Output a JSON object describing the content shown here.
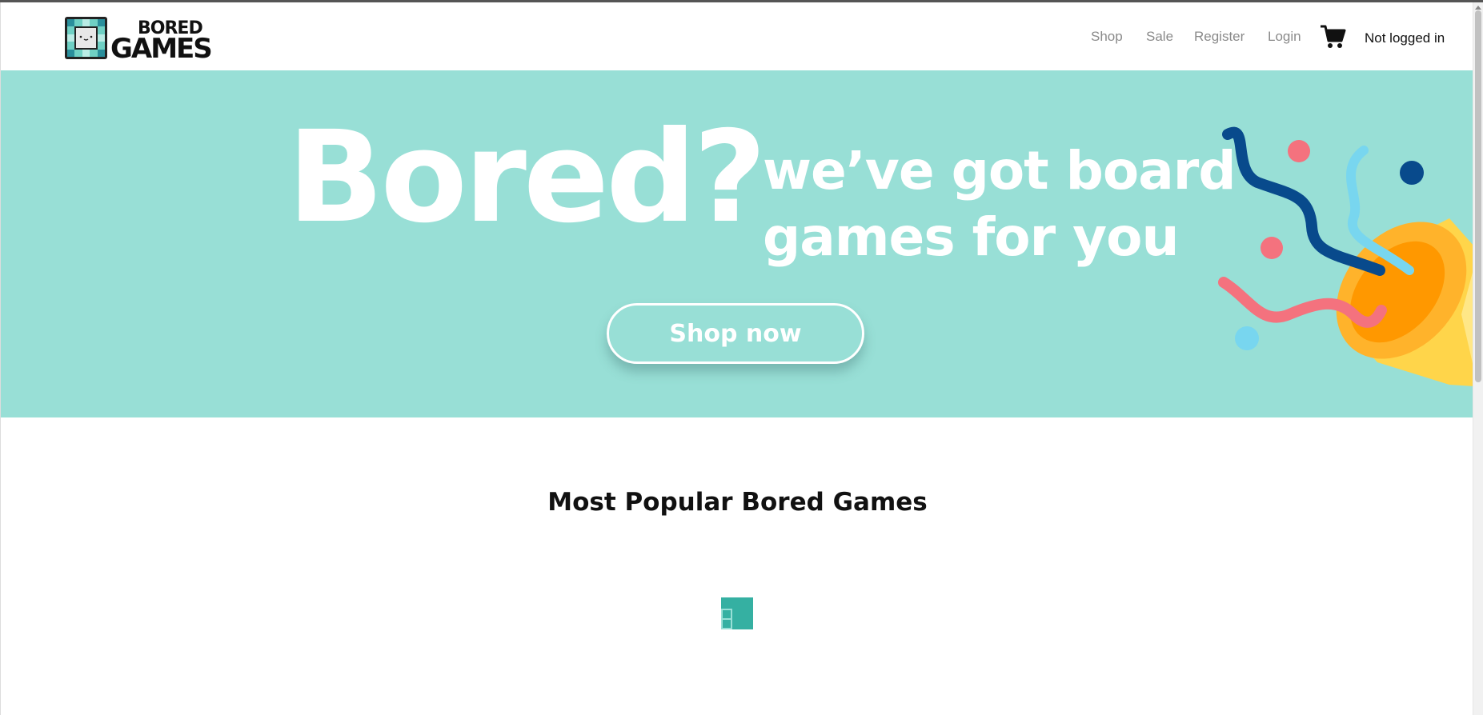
{
  "brand": {
    "logo_top": "BORED",
    "logo_bottom": "GAMES",
    "accent": "#98dfd6",
    "loader_color": "#35b0a2"
  },
  "nav": {
    "items": [
      {
        "label": "Shop"
      },
      {
        "label": "Sale"
      },
      {
        "label": "Register"
      },
      {
        "label": "Login"
      }
    ],
    "cart_icon": "cart-icon",
    "user_status": "Not logged in"
  },
  "hero": {
    "headline": "Bored?",
    "subline_1": "we’ve got board",
    "subline_2": "games for you",
    "cta_label": "Shop now",
    "illustration": "party-popper-confetti"
  },
  "popular": {
    "title": "Most Popular Bored Games",
    "loader_icon": "loading-squares-icon"
  }
}
